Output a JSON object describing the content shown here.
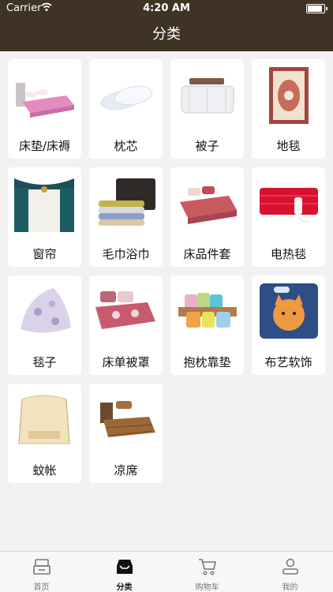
{
  "status_bar": {
    "carrier": "Carrier",
    "time": "4:20 AM",
    "battery_level": 0.9
  },
  "nav": {
    "title": "分类"
  },
  "categories": [
    {
      "label": "床垫/床褥",
      "icon": "bed-mattress-image"
    },
    {
      "label": "枕芯",
      "icon": "pillow-image"
    },
    {
      "label": "被子",
      "icon": "quilt-image"
    },
    {
      "label": "地毯",
      "icon": "carpet-image"
    },
    {
      "label": "窗帘",
      "icon": "curtain-image"
    },
    {
      "label": "毛巾浴巾",
      "icon": "towel-image"
    },
    {
      "label": "床品件套",
      "icon": "bedding-set-image"
    },
    {
      "label": "电热毯",
      "icon": "electric-blanket-image"
    },
    {
      "label": "毯子",
      "icon": "blanket-image"
    },
    {
      "label": "床单被罩",
      "icon": "bed-sheet-image"
    },
    {
      "label": "抱枕靠垫",
      "icon": "cushion-image"
    },
    {
      "label": "布艺软饰",
      "icon": "fabric-decor-image"
    },
    {
      "label": "蚊帐",
      "icon": "mosquito-net-image"
    },
    {
      "label": "凉席",
      "icon": "summer-mat-image"
    }
  ],
  "tabbar": {
    "items": [
      {
        "label": "首页",
        "icon": "home-icon"
      },
      {
        "label": "分类",
        "icon": "category-icon",
        "active": true
      },
      {
        "label": "购物车",
        "icon": "cart-icon"
      },
      {
        "label": "我的",
        "icon": "profile-icon"
      }
    ]
  }
}
